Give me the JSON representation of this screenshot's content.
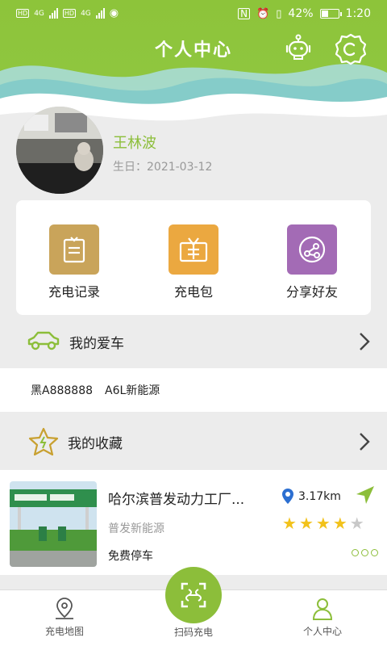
{
  "status_bar": {
    "net_left_1": "4G",
    "net_left_2": "4G",
    "battery": "42%",
    "battery_level": 0.42,
    "time": "1:20"
  },
  "header": {
    "title": "个人中心",
    "service_icon": "robot-service-icon",
    "settings_icon": "gear-icon"
  },
  "profile": {
    "name": "王林波",
    "birthday": "生日：2021-03-12"
  },
  "menu": [
    {
      "label": "充电记录",
      "icon": "charging-record-icon",
      "color": "#c9a45a"
    },
    {
      "label": "充电包",
      "icon": "charging-package-icon",
      "color": "#eba840"
    },
    {
      "label": "分享好友",
      "icon": "share-icon",
      "color": "#a36bb5"
    }
  ],
  "my_car": {
    "title": "我的爱车",
    "plate": "黑A888888",
    "model": "A6L新能源"
  },
  "favorites": {
    "title": "我的收藏"
  },
  "station": {
    "name": "哈尔滨普发动力工厂...",
    "distance": "3.17km",
    "company": "普发新能源",
    "parking": "免费停车",
    "rating": 4,
    "max_rating": 5
  },
  "bottom_nav": {
    "map": "充电地图",
    "scan": "扫码充电",
    "profile": "个人中心"
  },
  "colors": {
    "brand": "#8cbe3a",
    "text_muted": "#999999"
  }
}
